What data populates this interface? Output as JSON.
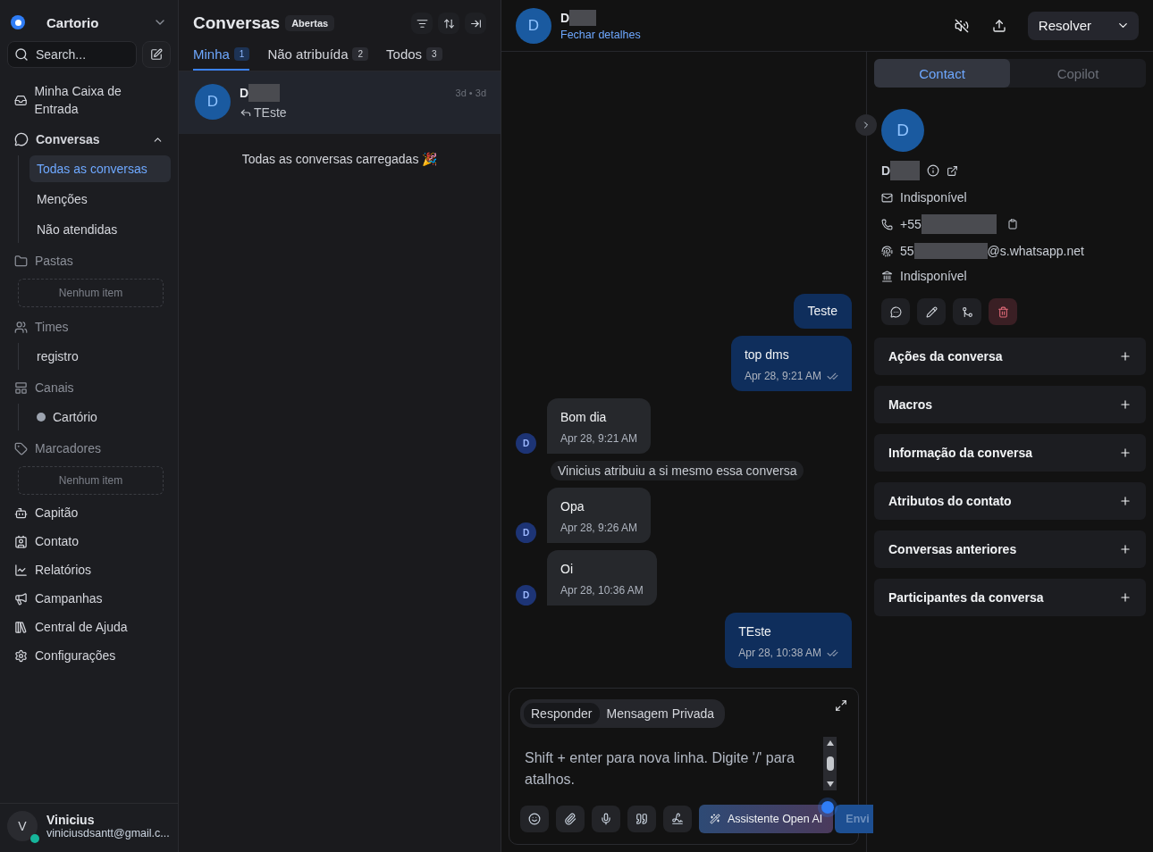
{
  "sidebar": {
    "account": "Cartorio",
    "search": {
      "placeholder": "Search..."
    },
    "nav": [
      {
        "kind": "link",
        "label": "Minha Caixa de Entrada"
      },
      {
        "kind": "group",
        "label": "Conversas",
        "expanded": true,
        "children": [
          {
            "label": "Todas as conversas",
            "selected": true
          },
          {
            "label": "Menções",
            "selected": false
          },
          {
            "label": "Não atendidas",
            "selected": false
          }
        ]
      },
      {
        "kind": "section",
        "label": "Pastas",
        "empty": "Nenhum item"
      },
      {
        "kind": "section",
        "label": "Times",
        "children": [
          {
            "label": "registro",
            "selected": false
          }
        ]
      },
      {
        "kind": "section",
        "label": "Canais",
        "children": [
          {
            "label": "Cartório",
            "selected": false
          }
        ]
      },
      {
        "kind": "section",
        "label": "Marcadores",
        "empty": "Nenhum item"
      },
      {
        "kind": "link",
        "label": "Capitão"
      },
      {
        "kind": "link",
        "label": "Contato"
      },
      {
        "kind": "link",
        "label": "Relatórios"
      },
      {
        "kind": "link",
        "label": "Campanhas"
      },
      {
        "kind": "link",
        "label": "Central de Ajuda"
      },
      {
        "kind": "link",
        "label": "Configurações"
      }
    ],
    "user": {
      "initial": "V",
      "name": "Vinicius",
      "email": "viniciusdsantt@gmail.c...",
      "online": true
    }
  },
  "list": {
    "title": "Conversas",
    "filter": "Abertas",
    "tabs": [
      {
        "label": "Minha",
        "count": "1",
        "selected": true
      },
      {
        "label": "Não atribuída",
        "count": "2",
        "selected": false
      },
      {
        "label": "Todos",
        "count": "3",
        "selected": false
      }
    ],
    "conversations": [
      {
        "initial": "D",
        "name": "D",
        "preview": "TEste",
        "time": "3d • 3d",
        "selected": true
      }
    ],
    "footer": "Todas as conversas carregadas 🎉"
  },
  "chat": {
    "contact": {
      "initial": "D",
      "name": "D",
      "link": "Fechar detalhes"
    },
    "resolve": "Resolver",
    "messages": [
      {
        "kind": "outgoing",
        "text": "Teste"
      },
      {
        "kind": "outgoing",
        "text": "top dms",
        "time": "Apr 28, 9:21 AM"
      },
      {
        "kind": "incoming",
        "initial": "D",
        "text": "Bom dia",
        "time": "Apr 28, 9:21 AM"
      },
      {
        "kind": "activity",
        "text": "Vinicius atribuiu a si mesmo essa conversa"
      },
      {
        "kind": "incoming",
        "initial": "D",
        "text": "Opa",
        "time": "Apr 28, 9:26 AM"
      },
      {
        "kind": "incoming",
        "initial": "D",
        "text": "Oi",
        "time": "Apr 28, 10:36 AM"
      },
      {
        "kind": "outgoing",
        "text": "TEste",
        "time": "Apr 28, 10:38 AM"
      }
    ],
    "composer": {
      "tabs": [
        {
          "label": "Responder",
          "selected": true
        },
        {
          "label": "Mensagem Privada",
          "selected": false
        }
      ],
      "placeholder": "Shift + enter para nova linha. Digite '/' para atalhos.",
      "assistant": "Assistente Open AI",
      "send": "Envi"
    }
  },
  "panel": {
    "tabs": [
      {
        "label": "Contact",
        "selected": true
      },
      {
        "label": "Copilot",
        "selected": false
      }
    ],
    "contact": {
      "initial": "D",
      "name": "D",
      "email": "Indisponível",
      "phone": "+55",
      "identifier_prefix": "55",
      "identifier_suffix": "@s.whatsapp.net",
      "company": "Indisponível"
    },
    "sections": [
      {
        "title": "Ações da conversa",
        "expanded": false
      },
      {
        "title": "Macros",
        "expanded": false
      },
      {
        "title": "Informação da conversa",
        "expanded": false
      },
      {
        "title": "Atributos do contato",
        "expanded": false
      },
      {
        "title": "Conversas anteriores",
        "expanded": false
      },
      {
        "title": "Participantes da conversa",
        "expanded": false
      }
    ]
  }
}
